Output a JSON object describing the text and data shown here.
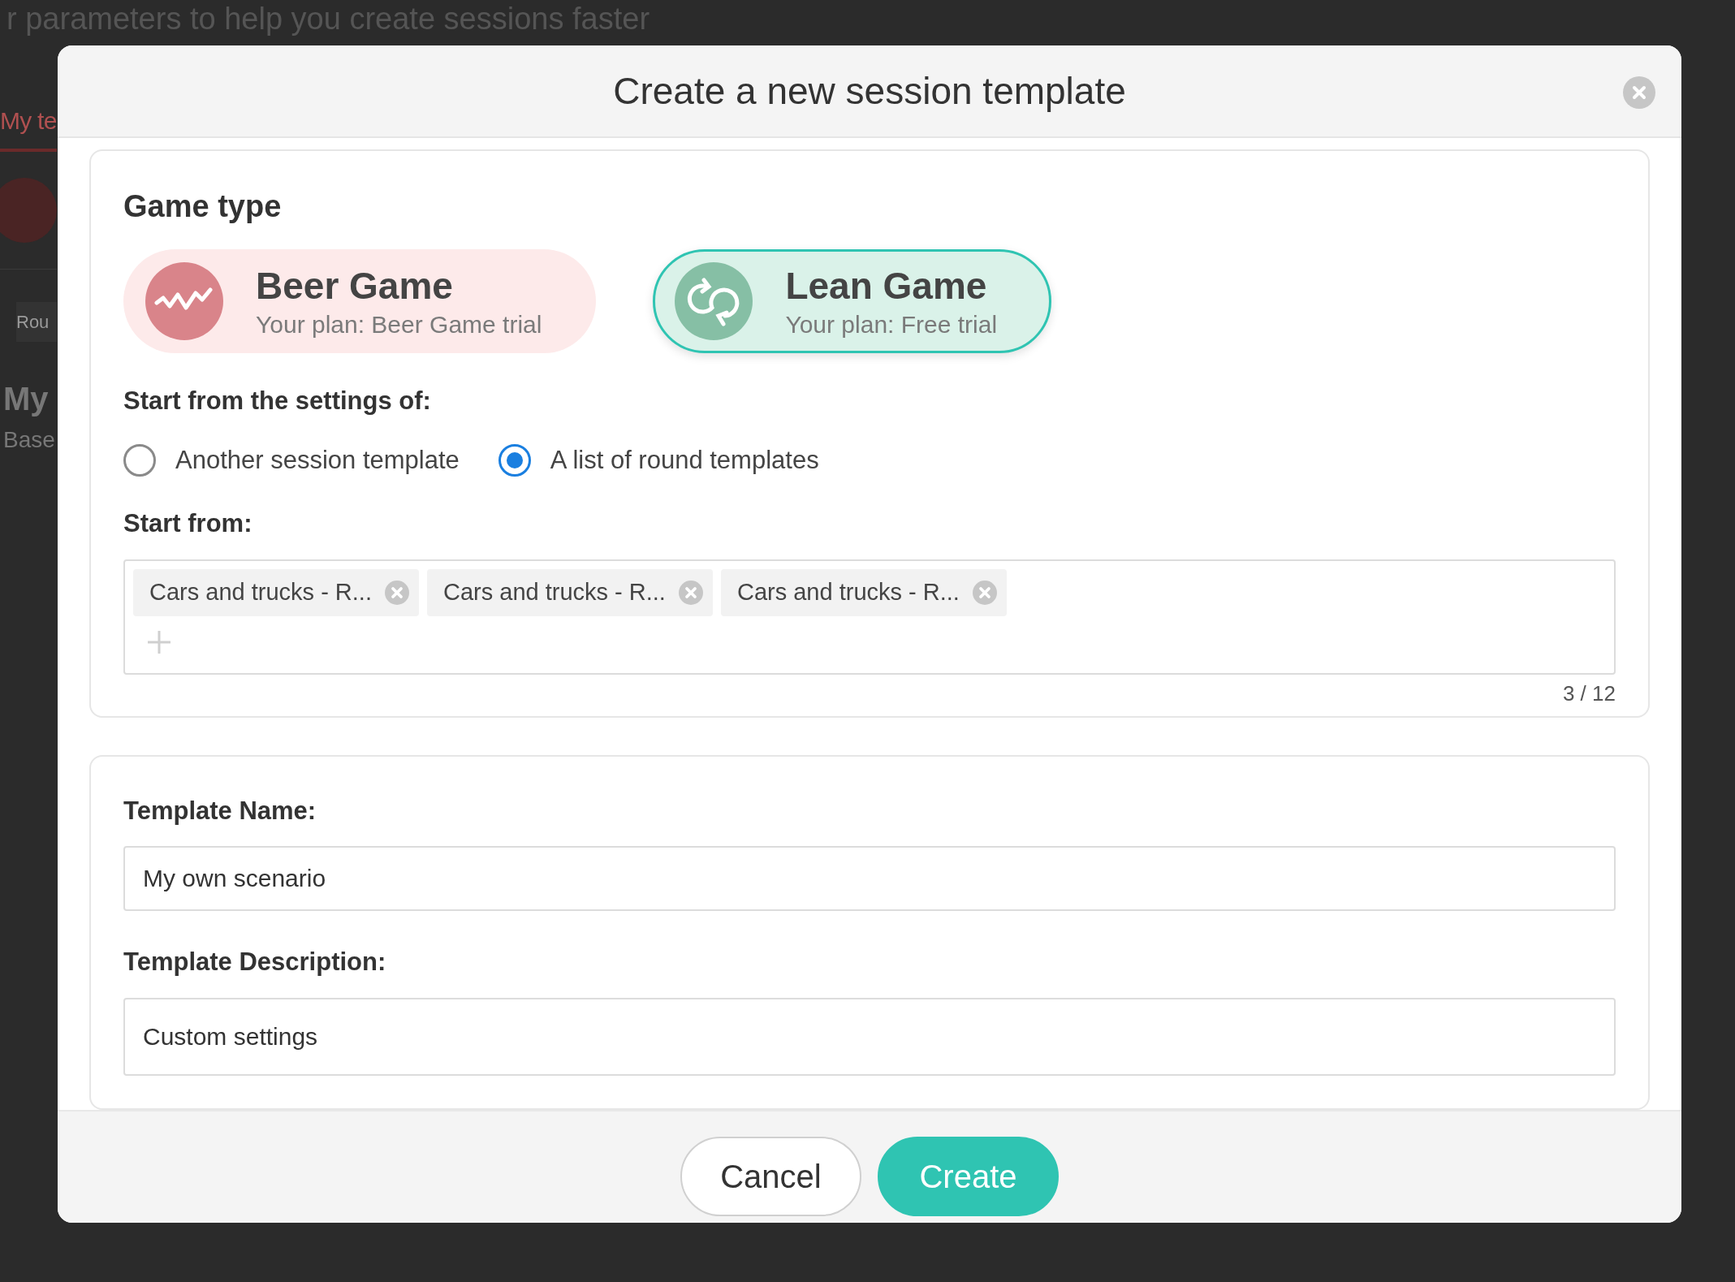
{
  "background": {
    "subtitle": "r parameters to help you create sessions faster",
    "tab": "My te",
    "chip": "Rou",
    "heading": "My",
    "caption": "Base"
  },
  "modal": {
    "title": "Create a new session template",
    "game_type": {
      "heading": "Game type",
      "options": [
        {
          "kind": "beer",
          "name": "Beer Game",
          "plan": "Your plan: Beer Game trial",
          "color": "#d9848a",
          "selected": false
        },
        {
          "kind": "lean",
          "name": "Lean Game",
          "plan": "Your plan: Free trial",
          "color": "#86bfa5",
          "selected": true
        }
      ]
    },
    "start_settings": {
      "label": "Start from the settings of:",
      "options": [
        {
          "label": "Another session template",
          "selected": false
        },
        {
          "label": "A list of round templates",
          "selected": true
        }
      ]
    },
    "start_from": {
      "label": "Start from:",
      "tags": [
        "Cars and trucks - R...",
        "Cars and trucks - R...",
        "Cars and trucks - R..."
      ],
      "counter": "3 / 12"
    },
    "template_name": {
      "label": "Template Name:",
      "value": "My own scenario"
    },
    "template_description": {
      "label": "Template Description:",
      "value": "Custom settings"
    },
    "buttons": [
      {
        "label": "Cancel",
        "kind": "secondary"
      },
      {
        "label": "Create",
        "kind": "primary"
      }
    ]
  }
}
